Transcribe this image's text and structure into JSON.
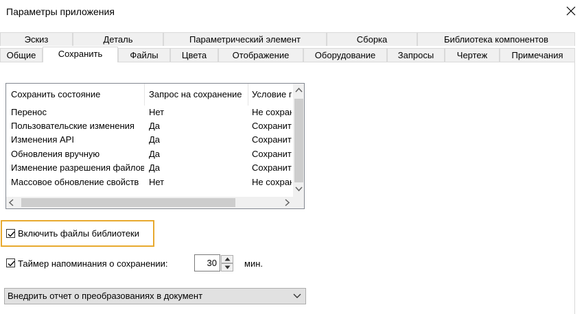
{
  "window": {
    "title": "Параметры приложения"
  },
  "tabs": {
    "row1": [
      "Эскиз",
      "Деталь",
      "Параметрический элемент",
      "Сборка",
      "Библиотека компонентов"
    ],
    "row2": [
      "Общие",
      "Сохранить",
      "Файлы",
      "Цвета",
      "Отображение",
      "Оборудование",
      "Запросы",
      "Чертеж",
      "Примечания"
    ],
    "selected": "Сохранить"
  },
  "table": {
    "columns": [
      "Сохранить состояние",
      "Запрос на сохранение",
      "Условие п"
    ],
    "rows": [
      [
        "Перенос",
        "Нет",
        "Не сохран"
      ],
      [
        "Пользовательские изменения",
        "Да",
        "Сохранит"
      ],
      [
        "Изменения API",
        "Да",
        "Сохранит"
      ],
      [
        "Обновления вручную",
        "Да",
        "Сохранит"
      ],
      [
        "Изменение разрешения файлов",
        "Да",
        "Сохранит"
      ],
      [
        "Массовое обновление свойств",
        "Нет",
        "Не сохран"
      ]
    ]
  },
  "options": {
    "include_library_files": {
      "label": "Включить файлы библиотеки",
      "checked": true
    },
    "save_reminder": {
      "label": "Таймер напоминания о сохранении:",
      "checked": true,
      "value": "30",
      "unit": "мин."
    }
  },
  "dropdown": {
    "selected": "Внедрить отчет о преобразованиях в документ"
  },
  "colors": {
    "highlight": "#e8a92e",
    "tab_bg": "#f0f0f0",
    "border": "#d9d9d9"
  }
}
